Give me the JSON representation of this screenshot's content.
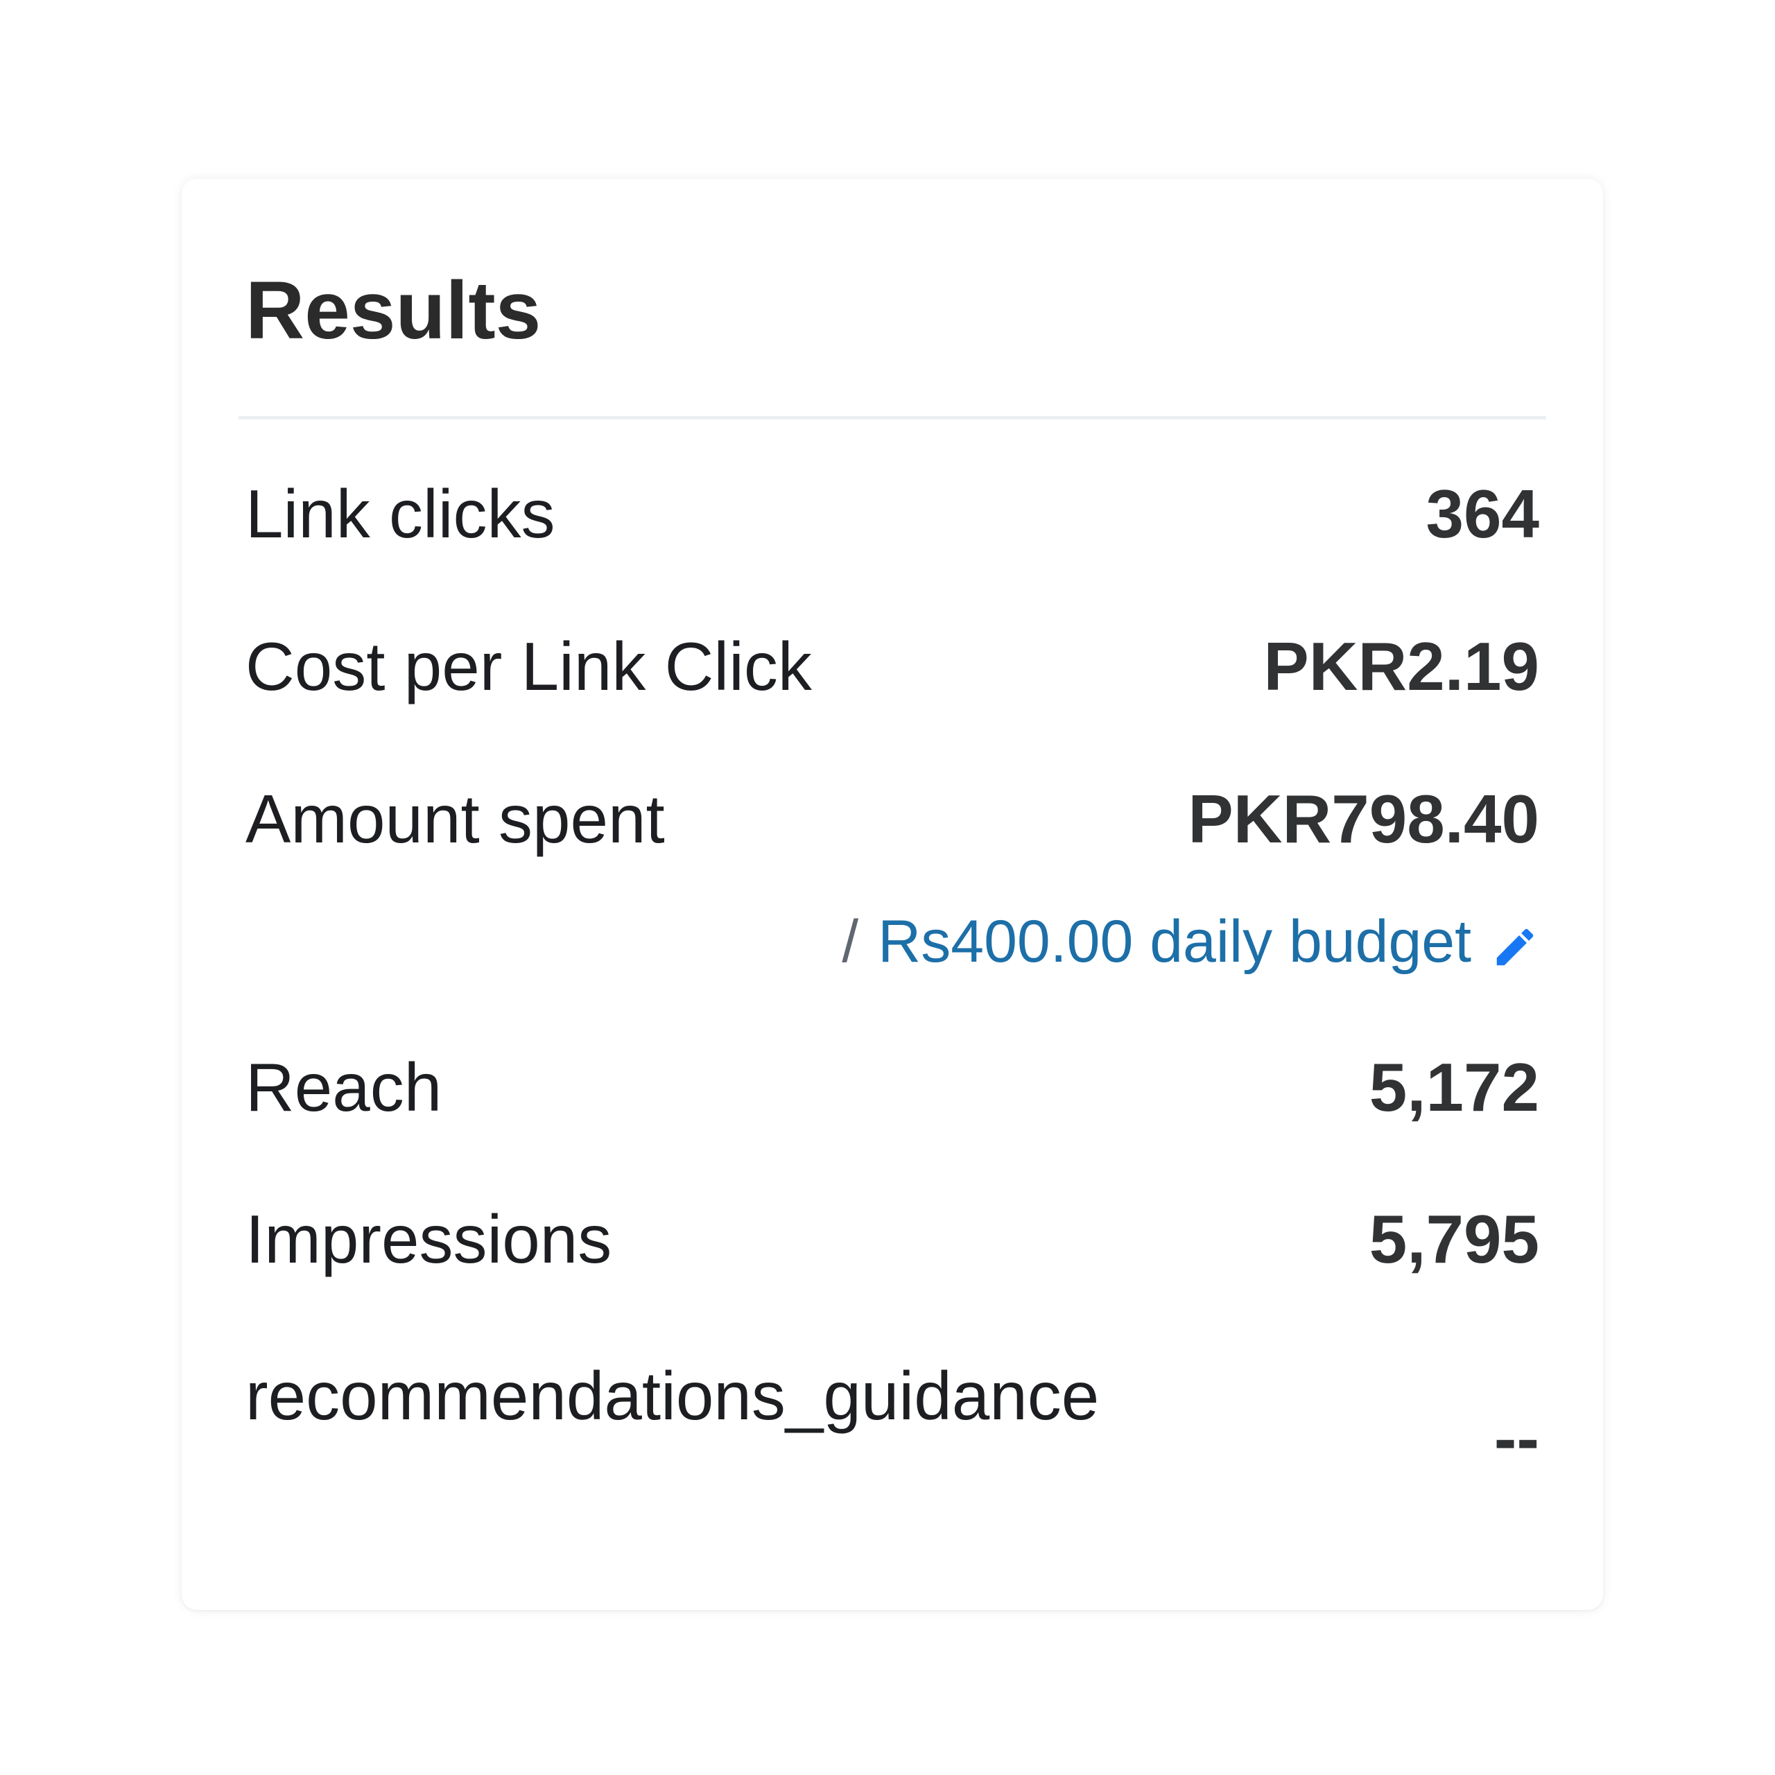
{
  "card": {
    "title": "Results",
    "metrics": [
      {
        "label": "Link clicks",
        "value": "364"
      },
      {
        "label": "Cost per Link Click",
        "value": "PKR2.19"
      },
      {
        "label": "Amount spent",
        "value": "PKR798.40"
      },
      {
        "label": "Reach",
        "value": "5,172"
      },
      {
        "label": "Impressions",
        "value": "5,795"
      },
      {
        "label": "recommendations_guidance",
        "value": "--"
      }
    ],
    "budget": {
      "separator": "/",
      "link_text": "Rs400.00 daily budget",
      "icon": "pencil-edit-icon"
    }
  },
  "colors": {
    "link": "#1d6fa8",
    "icon": "#1877f2",
    "value_text": "#303234",
    "label_text": "#1c1e21"
  }
}
